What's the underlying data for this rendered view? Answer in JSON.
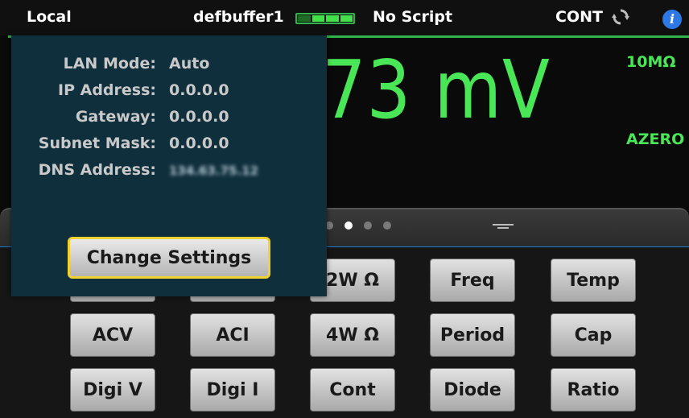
{
  "statusbar": {
    "mode": "Local",
    "buffer": "defbuffer1",
    "script": "No Script",
    "trigger": "CONT",
    "battery_icon": "battery-level-icon",
    "trigger_icon": "continuous-trigger-icon",
    "info_icon": "info-icon",
    "info_glyph": "i"
  },
  "measurement": {
    "reading": "73 mV",
    "input_impedance": "10MΩ",
    "autozero": "AZERO"
  },
  "swipe": {
    "page_count": 4,
    "active_page": 2
  },
  "lan_popup": {
    "rows": [
      {
        "label": "LAN Mode:",
        "value": "Auto"
      },
      {
        "label": "IP Address:",
        "value": "0.0.0.0"
      },
      {
        "label": "Gateway:",
        "value": "0.0.0.0"
      },
      {
        "label": "Subnet Mask:",
        "value": "0.0.0.0"
      },
      {
        "label": "DNS Address:",
        "value": "134.63.75.12"
      }
    ],
    "button": "Change Settings"
  },
  "functions": {
    "row1": [
      "2W Ω",
      "Freq",
      "Temp"
    ],
    "row2": [
      "ACV",
      "ACI",
      "4W Ω",
      "Period",
      "Cap"
    ],
    "row3": [
      "Digi V",
      "Digi I",
      "Cont",
      "Diode",
      "Ratio"
    ]
  },
  "colors": {
    "reading_green": "#49e657",
    "popup_bg": "#0f2f3d",
    "accent_yellow": "#f2d232",
    "swipe_blue": "#1f7fd0"
  }
}
